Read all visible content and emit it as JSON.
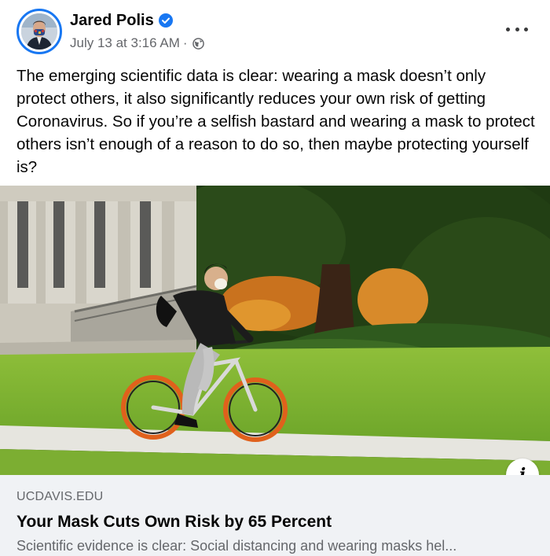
{
  "post": {
    "author": "Jared Polis",
    "timestamp": "July 13 at 3:16 AM",
    "separator": "·",
    "text": "The emerging scientific data is clear: wearing a mask doesn’t only protect others, it also significantly reduces your own risk of getting Coronavirus. So if you’re a selfish bastard and wearing a mask to protect others isn’t enough of a reason to do so, then maybe protecting yourself is?"
  },
  "icons": {
    "verified": "verified-badge-icon",
    "audience": "globe-icon",
    "more": "more-options-icon",
    "info": "info-icon"
  },
  "link_preview": {
    "domain": "UCDAVIS.EDU",
    "title": "Your Mask Cuts Own Risk by 65 Percent",
    "description": "Scientific evidence is clear: Social distancing and wearing masks hel..."
  },
  "colors": {
    "accent": "#1877f2",
    "secondary_text": "#65676b",
    "link_box_bg": "#f0f2f5"
  }
}
